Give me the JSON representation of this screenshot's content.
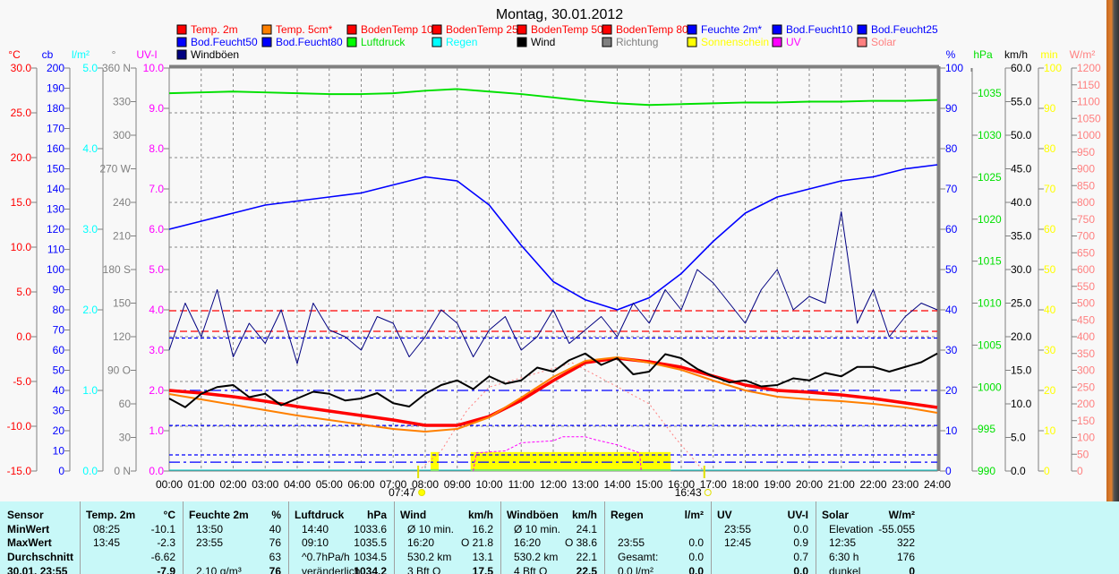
{
  "title": "Montag, 30.01.2012",
  "legend": [
    [
      {
        "label": "Temp. 2m",
        "box": "#ff0000",
        "text": "#ff0000"
      },
      {
        "label": "Temp. 5cm*",
        "box": "#ff8000",
        "text": "#ff0000"
      },
      {
        "label": "BodenTemp 10",
        "box": "#ff0000",
        "text": "#ff0000"
      },
      {
        "label": "BodenTemp 25",
        "box": "#ff0000",
        "text": "#ff0000"
      },
      {
        "label": "BodenTemp 50",
        "box": "#ff0000",
        "text": "#ff0000"
      },
      {
        "label": "BodenTemp 80",
        "box": "#ff0000",
        "text": "#ff0000"
      },
      {
        "label": "Feuchte 2m*",
        "box": "#0000ff",
        "text": "#0000ff"
      },
      {
        "label": "Bod.Feucht10",
        "box": "#0000ff",
        "text": "#0000ff"
      },
      {
        "label": "Bod.Feucht25",
        "box": "#0000ff",
        "text": "#0000ff"
      }
    ],
    [
      {
        "label": "Bod.Feucht50",
        "box": "#0000ff",
        "text": "#0000ff"
      },
      {
        "label": "Bod.Feucht80",
        "box": "#0000ff",
        "text": "#0000ff"
      },
      {
        "label": "Luftdruck",
        "box": "#00ff00",
        "text": "#00e000"
      },
      {
        "label": "Regen",
        "box": "#00ffff",
        "text": "#00ffff"
      },
      {
        "label": "Wind",
        "box": "#000000",
        "text": "#000000"
      },
      {
        "label": "Richtung",
        "box": "#808080",
        "text": "#808080"
      },
      {
        "label": "Sonnenschein",
        "box": "#ffff00",
        "text": "#ffff00"
      },
      {
        "label": "UV",
        "box": "#ff00ff",
        "text": "#ff00ff"
      },
      {
        "label": "Solar",
        "box": "#ff8080",
        "text": "#ff8080"
      }
    ],
    [
      {
        "label": "Windböen",
        "box": "#000080",
        "text": "#000000"
      }
    ]
  ],
  "chart_data": {
    "type": "line",
    "title": "Montag, 30.01.2012",
    "x_labels": [
      "00:00",
      "01:00",
      "02:00",
      "03:00",
      "04:00",
      "05:00",
      "06:00",
      "07:00",
      "08:00",
      "09:00",
      "10:00",
      "11:00",
      "12:00",
      "13:00",
      "14:00",
      "15:00",
      "16:00",
      "17:00",
      "18:00",
      "19:00",
      "20:00",
      "21:00",
      "22:00",
      "23:00",
      "24:00"
    ],
    "xlim": [
      0,
      24
    ],
    "left_axes": [
      {
        "unit": "°C",
        "color": "#ff0000",
        "range": [
          -15,
          30
        ],
        "ticks": [
          "-15.0",
          "-10.0",
          "-5.0",
          "0.0",
          "5.0",
          "10.0",
          "15.0",
          "20.0",
          "25.0",
          "30.0"
        ]
      },
      {
        "unit": "cb",
        "color": "#0000ff",
        "range": [
          0,
          200
        ],
        "ticks": [
          "0",
          "10",
          "20",
          "30",
          "40",
          "50",
          "60",
          "70",
          "80",
          "90",
          "100",
          "110",
          "120",
          "130",
          "140",
          "150",
          "160",
          "170",
          "180",
          "190",
          "200"
        ]
      },
      {
        "unit": "l/m²",
        "color": "#00ffff",
        "range": [
          0,
          5
        ],
        "ticks": [
          "0.0",
          "1.0",
          "2.0",
          "3.0",
          "4.0",
          "5.0"
        ]
      },
      {
        "unit": "°",
        "color": "#808080",
        "range": [
          0,
          360
        ],
        "ticks": [
          "0   N",
          "30",
          "60",
          "90  O",
          "120",
          "150",
          "180 S",
          "210",
          "240",
          "270 W",
          "300",
          "330",
          "360 N"
        ]
      },
      {
        "unit": "UV-I",
        "color": "#ff00ff",
        "range": [
          0,
          10
        ],
        "ticks": [
          "0.0",
          "1.0",
          "2.0",
          "3.0",
          "4.0",
          "5.0",
          "6.0",
          "7.0",
          "8.0",
          "9.0",
          "10.0"
        ]
      }
    ],
    "right_axes": [
      {
        "unit": "%",
        "color": "#0000ff",
        "range": [
          0,
          100
        ],
        "ticks": [
          "0",
          "10",
          "20",
          "30",
          "40",
          "50",
          "60",
          "70",
          "80",
          "90",
          "100"
        ]
      },
      {
        "unit": "hPa",
        "color": "#00e000",
        "range": [
          990,
          1038
        ],
        "tick_values": [
          990,
          995,
          1000,
          1005,
          1010,
          1015,
          1020,
          1025,
          1030,
          1035
        ],
        "ticks": [
          "990",
          "995",
          "1000",
          "1005",
          "1010",
          "1015",
          "1020",
          "1025",
          "1030",
          "1035"
        ]
      },
      {
        "unit": "km/h",
        "color": "#000000",
        "range": [
          0,
          60
        ],
        "ticks": [
          "0.0",
          "5.0",
          "10.0",
          "15.0",
          "20.0",
          "25.0",
          "30.0",
          "35.0",
          "40.0",
          "45.0",
          "50.0",
          "55.0",
          "60.0"
        ]
      },
      {
        "unit": "min",
        "color": "#ffff00",
        "range": [
          0,
          100
        ],
        "ticks": [
          "0",
          "10",
          "20",
          "30",
          "40",
          "50",
          "60",
          "70",
          "80",
          "90",
          "100"
        ]
      },
      {
        "unit": "W/m²",
        "color": "#ff8080",
        "range": [
          0,
          1200
        ],
        "ticks": [
          "0",
          "50",
          "100",
          "150",
          "200",
          "250",
          "300",
          "350",
          "400",
          "450",
          "500",
          "550",
          "600",
          "650",
          "700",
          "750",
          "800",
          "850",
          "900",
          "950",
          "1000",
          "1050",
          "1100",
          "1150",
          "1200"
        ]
      }
    ],
    "series": [
      {
        "name": "Temp. 2m",
        "axis": "°C",
        "color": "#ff0000",
        "width": 3.5,
        "step_h": 1,
        "values": [
          -6.0,
          -6.3,
          -6.7,
          -7.2,
          -7.8,
          -8.3,
          -8.8,
          -9.3,
          -9.9,
          -9.9,
          -8.9,
          -7.1,
          -4.9,
          -2.9,
          -2.4,
          -2.8,
          -3.4,
          -4.4,
          -5.4,
          -6.0,
          -6.2,
          -6.5,
          -6.9,
          -7.4,
          -7.9
        ]
      },
      {
        "name": "Temp. 5cm*",
        "axis": "°C",
        "color": "#ff8000",
        "width": 2,
        "step_h": 1,
        "values": [
          -6.4,
          -7.0,
          -7.6,
          -8.2,
          -8.8,
          -9.3,
          -9.8,
          -10.3,
          -10.6,
          -10.3,
          -9.0,
          -6.8,
          -4.5,
          -2.7,
          -2.3,
          -2.9,
          -3.7,
          -4.9,
          -6.0,
          -6.7,
          -7.0,
          -7.2,
          -7.5,
          -7.9,
          -8.5
        ]
      },
      {
        "name": "Feuchte 2m*",
        "axis": "%",
        "color": "#0000ff",
        "width": 1.6,
        "step_h": 1,
        "values": [
          60,
          62,
          64,
          66,
          67,
          68,
          69,
          71,
          73,
          72,
          66,
          56,
          47,
          42.5,
          40,
          43,
          49,
          57,
          64,
          68,
          70,
          72,
          73,
          75,
          76
        ]
      },
      {
        "name": "Luftdruck",
        "axis": "hPa",
        "color": "#00e000",
        "width": 2,
        "step_h": 1,
        "values": [
          1035.0,
          1035.1,
          1035.2,
          1035.1,
          1035.0,
          1034.9,
          1034.9,
          1035.0,
          1035.3,
          1035.5,
          1035.2,
          1034.9,
          1034.5,
          1034.1,
          1033.8,
          1033.6,
          1033.7,
          1033.8,
          1033.9,
          1033.9,
          1034.0,
          1034.0,
          1034.1,
          1034.1,
          1034.2
        ]
      },
      {
        "name": "Windböen",
        "axis": "km/h",
        "color": "#000080",
        "width": 1,
        "step_h": 0.5,
        "values": [
          18,
          25,
          20,
          27,
          17,
          22,
          19,
          24,
          16,
          25,
          21,
          20,
          18,
          23,
          22,
          17,
          20,
          24,
          22,
          17,
          21,
          23,
          18,
          20,
          24,
          19,
          21,
          23,
          20,
          25,
          22,
          27,
          24,
          30,
          28,
          25,
          22,
          27,
          30,
          24,
          26,
          25,
          38.6,
          22,
          27,
          20,
          23,
          25,
          24
        ]
      },
      {
        "name": "Wind",
        "axis": "km/h",
        "color": "#000000",
        "width": 2,
        "step_h": 0.5,
        "values": [
          10.8,
          9.5,
          11.5,
          12.5,
          12.8,
          11,
          11.5,
          9.8,
          10.8,
          11.8,
          11.5,
          10.5,
          10.8,
          11.6,
          10.1,
          9.6,
          11.5,
          12.8,
          13.5,
          12.2,
          14.1,
          13,
          13.5,
          15.4,
          14.8,
          16.5,
          17.5,
          15.8,
          16.8,
          14.4,
          14.8,
          17.4,
          16.8,
          15.2,
          14.1,
          13.2,
          13.5,
          12.6,
          12.8,
          13.8,
          13.5,
          14.6,
          14.1,
          15.5,
          15.5,
          14.8,
          15.5,
          16.2,
          17.5
        ]
      }
    ],
    "uv_points": [
      [
        9.5,
        0
      ],
      [
        9.6,
        0.45
      ],
      [
        10.5,
        0.5
      ],
      [
        11,
        0.7
      ],
      [
        12,
        0.75
      ],
      [
        12.3,
        0.85
      ],
      [
        13,
        0.85
      ],
      [
        13.3,
        0.78
      ],
      [
        14,
        0.65
      ],
      [
        14.7,
        0.45
      ],
      [
        14.75,
        0
      ]
    ],
    "solar_points": [
      [
        7.78,
        0
      ],
      [
        8.5,
        60
      ],
      [
        9.3,
        180
      ],
      [
        10,
        250
      ],
      [
        12.6,
        322
      ],
      [
        15,
        200
      ],
      [
        15.8,
        100
      ],
      [
        16.7,
        0
      ]
    ],
    "sunshine": [
      {
        "from": 8.17,
        "to": 8.42,
        "minutes": 4.7
      },
      {
        "from": 9.42,
        "to": 15.67,
        "minutes": 4.7
      }
    ],
    "reference_lines": [
      {
        "axis": "°C",
        "value": 2.9,
        "color": "#ff0000",
        "dash": "8,4"
      },
      {
        "axis": "°C",
        "value": 0.6,
        "color": "#ff0000",
        "dash": "8,4"
      },
      {
        "axis": "%",
        "value": 33,
        "color": "#0000ff",
        "dash": "4,3"
      },
      {
        "axis": "%",
        "value": 20,
        "color": "#0000ff",
        "dash": "12,4,3,4"
      },
      {
        "axis": "%",
        "value": 11.3,
        "color": "#0000ff",
        "dash": "4,3"
      },
      {
        "axis": "%",
        "value": 4,
        "color": "#0000ff",
        "dash": "4,3"
      },
      {
        "axis": "%",
        "value": 2.2,
        "color": "#0000ff",
        "dash": "12,4,3,4"
      }
    ],
    "sunrise": {
      "label": "07:47",
      "hour": 7.78
    },
    "sunset": {
      "label": "16:43",
      "hour": 16.72
    },
    "grid": true
  },
  "stats": {
    "columns": [
      {
        "h1": "Sensor",
        "h2": "",
        "rows": [
          [
            "MinWert",
            ""
          ],
          [
            "MaxWert",
            ""
          ],
          [
            "Durchschnitt",
            ""
          ],
          [
            "30.01. 23:55",
            ""
          ]
        ]
      },
      {
        "h1": "Temp. 2m",
        "h2": "°C",
        "rows": [
          [
            "08:25",
            "-10.1"
          ],
          [
            "13:45",
            "-2.3"
          ],
          [
            "",
            "-6.62"
          ],
          [
            "",
            "-7.9"
          ]
        ]
      },
      {
        "h1": "Feuchte 2m",
        "h2": "%",
        "rows": [
          [
            "13:50",
            "40"
          ],
          [
            "23:55",
            "76"
          ],
          [
            "",
            "63"
          ],
          [
            "2.10 g/m³",
            "76"
          ]
        ]
      },
      {
        "h1": "Luftdruck",
        "h2": "hPa",
        "rows": [
          [
            "14:40",
            "1033.6"
          ],
          [
            "09:10",
            "1035.5"
          ],
          [
            "^0.7hPa/h",
            "1034.5"
          ],
          [
            "veränderlich",
            "1034.2"
          ]
        ]
      },
      {
        "h1": "Wind",
        "h2": "km/h",
        "rows": [
          [
            "Ø 10 min.",
            "16.2"
          ],
          [
            "16:20",
            "O 21.8"
          ],
          [
            "530.2 km",
            "13.1"
          ],
          [
            "3 Bft O",
            "17.5"
          ]
        ]
      },
      {
        "h1": "Windböen",
        "h2": "km/h",
        "rows": [
          [
            "Ø 10 min.",
            "24.1"
          ],
          [
            "16:20",
            "O 38.6"
          ],
          [
            "530.2 km",
            "22.1"
          ],
          [
            "4 Bft O",
            "22.5"
          ]
        ]
      },
      {
        "h1": "Regen",
        "h2": "l/m²",
        "rows": [
          [
            "",
            ""
          ],
          [
            "23:55",
            "0.0"
          ],
          [
            "Gesamt:",
            "0.0"
          ],
          [
            "0.0 l/m²",
            "0.0"
          ]
        ]
      },
      {
        "h1": "UV",
        "h2": "UV-I",
        "rows": [
          [
            "23:55",
            "0.0"
          ],
          [
            "12:45",
            "0.9"
          ],
          [
            "",
            "0.7"
          ],
          [
            "",
            "0.0"
          ]
        ]
      },
      {
        "h1": "Solar",
        "h2": "W/m²",
        "rows": [
          [
            "Elevation",
            "-55.055"
          ],
          [
            "12:35",
            "322"
          ],
          [
            "6:30 h",
            "176"
          ],
          [
            "dunkel",
            "0"
          ]
        ]
      }
    ]
  }
}
